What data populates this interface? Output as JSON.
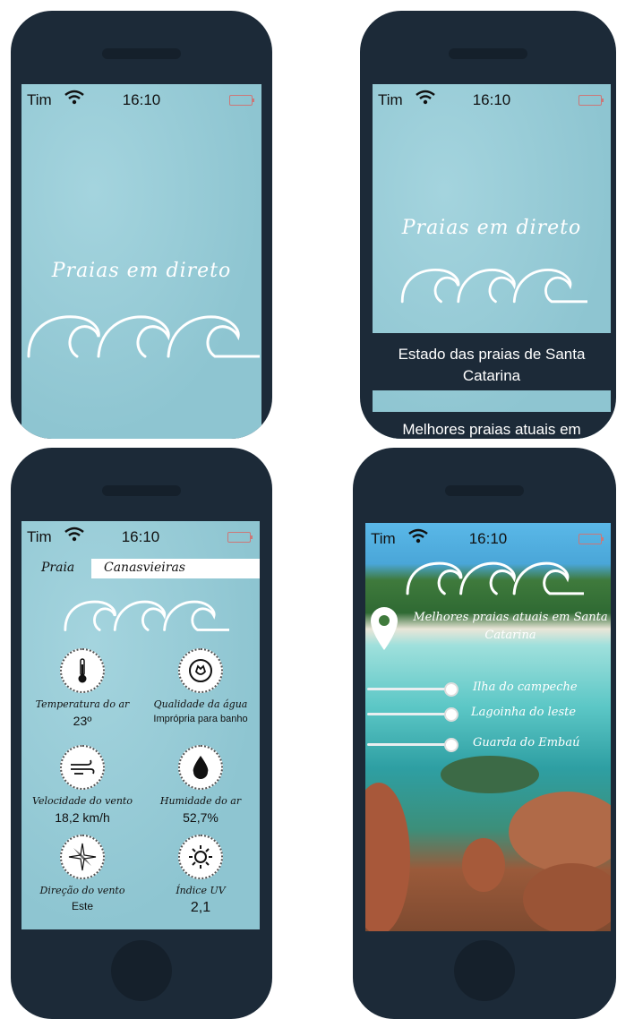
{
  "status": {
    "carrier": "Tim",
    "time": "16:10"
  },
  "splash": {
    "title": "Praias em direto"
  },
  "menu": {
    "title": "Praias em direto",
    "items": [
      "Estado das praias de Santa Catarina",
      "Melhores praias atuais em Santa Catarina"
    ]
  },
  "detail": {
    "beach_label": "Praia",
    "beach_value": "Canasvieiras",
    "metrics": [
      {
        "label": "Temperatura do ar",
        "value": "23º",
        "icon": "thermometer-icon"
      },
      {
        "label": "Qualidade da água",
        "value": "Imprópria para banho",
        "icon": "water-quality-icon"
      },
      {
        "label": "Velocidade do vento",
        "value": "18,2 km/h",
        "icon": "wind-icon"
      },
      {
        "label": "Humidade do ar",
        "value": "52,7%",
        "icon": "water-drop-icon"
      },
      {
        "label": "Direção do vento",
        "value": "Este",
        "icon": "compass-icon"
      },
      {
        "label": "Índice UV",
        "value": "2,1",
        "icon": "sun-icon"
      }
    ]
  },
  "best": {
    "title": "Melhores praias atuais em Santa Catarina",
    "beaches": [
      "Ilha do campeche",
      "Lagoinha do leste",
      "Guarda do Embaú"
    ]
  },
  "colors": {
    "phone": "#1c2a38",
    "screen": "#8ec5d1",
    "band": "#1c2a38"
  }
}
